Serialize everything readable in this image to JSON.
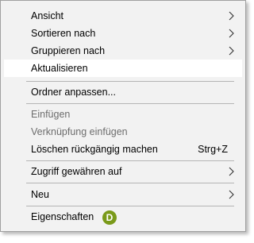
{
  "menu": {
    "items": [
      {
        "label": "Ansicht"
      },
      {
        "label": "Sortieren nach"
      },
      {
        "label": "Gruppieren nach"
      },
      {
        "label": "Aktualisieren"
      },
      {
        "label": "Ordner anpassen..."
      },
      {
        "label": "Einfügen"
      },
      {
        "label": "Verknüpfung einfügen"
      },
      {
        "label": "Löschen rückgängig machen",
        "shortcut": "Strg+Z"
      },
      {
        "label": "Zugriff gewähren auf"
      },
      {
        "label": "Neu"
      },
      {
        "label": "Eigenschaften"
      }
    ],
    "badge": {
      "text": "D",
      "color": "#7a9a1a"
    },
    "highlight_color": "#ffffff",
    "disabled_color": "#6d6d6d",
    "icons": {
      "submenu": "chevron-right-icon"
    }
  }
}
